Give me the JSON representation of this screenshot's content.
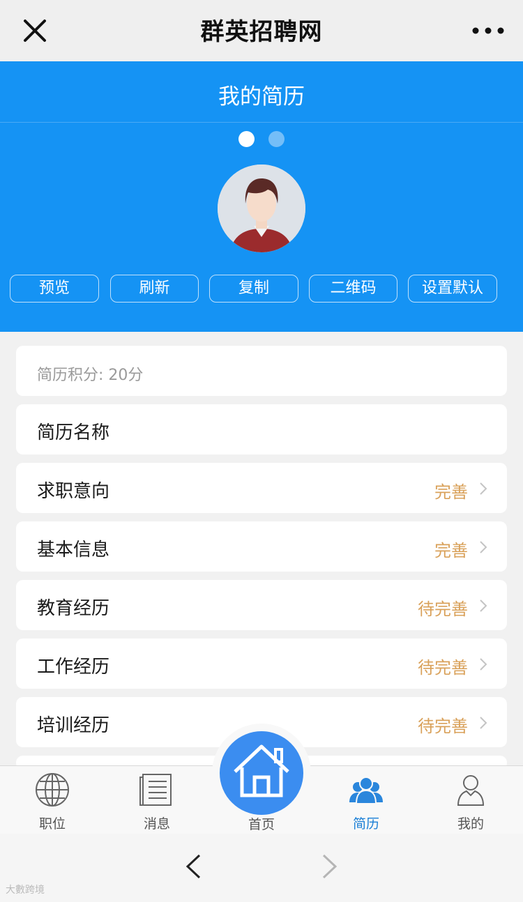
{
  "topbar": {
    "title": "群英招聘网",
    "close_icon": "close-icon",
    "more_icon": "more-icon"
  },
  "header": {
    "title": "我的简历",
    "carousel_dots": 2,
    "actions": [
      "预览",
      "刷新",
      "复制",
      "二维码",
      "设置默认"
    ]
  },
  "resume": {
    "score": "简历积分: 20分",
    "rows": [
      {
        "label": "简历名称",
        "status": ""
      },
      {
        "label": "求职意向",
        "status": "完善"
      },
      {
        "label": "基本信息",
        "status": "完善"
      },
      {
        "label": "教育经历",
        "status": "待完善"
      },
      {
        "label": "工作经历",
        "status": "待完善"
      },
      {
        "label": "培训经历",
        "status": "待完善"
      }
    ]
  },
  "tabbar": {
    "tabs": [
      {
        "label": "职位",
        "icon": "globe-icon"
      },
      {
        "label": "消息",
        "icon": "document-icon"
      },
      {
        "label": "首页",
        "icon": "home-icon"
      },
      {
        "label": "简历",
        "icon": "people-icon"
      },
      {
        "label": "我的",
        "icon": "person-icon"
      }
    ],
    "active": "简历"
  },
  "browser": {
    "back_icon": "chevron-left-icon",
    "forward_icon": "chevron-right-icon"
  },
  "watermark": "大數跨境",
  "colors": {
    "brand_blue": "#1593f4",
    "status_orange": "#d9a15a",
    "active_tab": "#1a7fd6"
  }
}
